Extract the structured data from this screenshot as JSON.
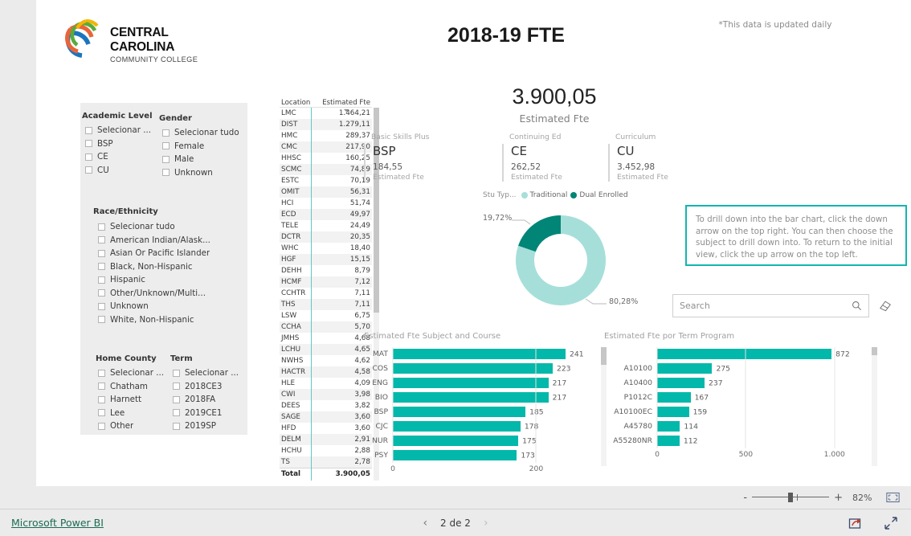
{
  "header": {
    "logo_line1": "CENTRAL CAROLINA",
    "logo_line2": "COMMUNITY COLLEGE",
    "title": "2018-19 FTE",
    "update_note": "*This data is updated daily"
  },
  "slicers": [
    {
      "title": "Academic Level",
      "items": [
        "Selecionar ...",
        "BSP",
        "CE",
        "CU"
      ]
    },
    {
      "title": "Gender",
      "items": [
        "Selecionar tudo",
        "Female",
        "Male",
        "Unknown"
      ]
    },
    {
      "title": "Race/Ethnicity",
      "items": [
        "Selecionar tudo",
        "American Indian/Alask...",
        "Asian Or Pacific Islander",
        "Black, Non-Hispanic",
        "Hispanic",
        "Other/Unknown/Multi...",
        "Unknown",
        "White, Non-Hispanic"
      ]
    },
    {
      "title": "Home County",
      "items": [
        "Selecionar ...",
        "Chatham",
        "Harnett",
        "Lee",
        "Other"
      ]
    },
    {
      "title": "Term",
      "items": [
        "Selecionar ...",
        "2018CE3",
        "2018FA",
        "2019CE1",
        "2019SP"
      ]
    }
  ],
  "table": {
    "columns": [
      "Location",
      "Estimated Fte"
    ],
    "rows": [
      [
        "LMC",
        "1.464,21"
      ],
      [
        "DIST",
        "1.279,11"
      ],
      [
        "HMC",
        "289,37"
      ],
      [
        "CMC",
        "217,90"
      ],
      [
        "HHSC",
        "160,25"
      ],
      [
        "SCMC",
        "74,89"
      ],
      [
        "ESTC",
        "70,19"
      ],
      [
        "OMIT",
        "56,31"
      ],
      [
        "HCI",
        "51,74"
      ],
      [
        "ECD",
        "49,97"
      ],
      [
        "TELE",
        "24,49"
      ],
      [
        "DCTR",
        "20,35"
      ],
      [
        "WHC",
        "18,40"
      ],
      [
        "HGF",
        "15,15"
      ],
      [
        "DEHH",
        "8,79"
      ],
      [
        "HCMF",
        "7,12"
      ],
      [
        "CCHTR",
        "7,11"
      ],
      [
        "THS",
        "7,11"
      ],
      [
        "LSW",
        "6,75"
      ],
      [
        "CCHA",
        "5,70"
      ],
      [
        "JMHS",
        "4,68"
      ],
      [
        "LCHU",
        "4,65"
      ],
      [
        "NWHS",
        "4,62"
      ],
      [
        "HACTR",
        "4,58"
      ],
      [
        "HLE",
        "4,09"
      ],
      [
        "CWI",
        "3,98"
      ],
      [
        "DEES",
        "3,82"
      ],
      [
        "SAGE",
        "3,60"
      ],
      [
        "HFD",
        "3,60"
      ],
      [
        "DELM",
        "2,91"
      ],
      [
        "HCHU",
        "2,88"
      ],
      [
        "TS",
        "2,78"
      ]
    ],
    "total_label": "Total",
    "total_value": "3.900,05"
  },
  "kpi": {
    "total_value": "3.900,05",
    "total_label": "Estimated Fte",
    "cards": [
      {
        "category": "Basic Skills Plus",
        "code": "BSP",
        "value": "184,55",
        "sublabel": "Estimated Fte"
      },
      {
        "category": "Continuing Ed",
        "code": "CE",
        "value": "262,52",
        "sublabel": "Estimated Fte"
      },
      {
        "category": "Curriculum",
        "code": "CU",
        "value": "3.452,98",
        "sublabel": "Estimated Fte"
      }
    ]
  },
  "info_box": {
    "text": "To drill down into the bar chart, click the down arrow on the top right.  You can then choose the subject to drill down into.  To return to the initial view, click the up arrow on the top left.",
    "border_color": "#13b5b1"
  },
  "search": {
    "placeholder": "Search",
    "value": "",
    "icon": "search-icon",
    "eraser_icon": "eraser-icon"
  },
  "status_bar": {
    "zoom_minus": "-",
    "zoom_plus": "+",
    "zoom_pct": "82%",
    "fit_icon": "fit-to-page-icon"
  },
  "footer": {
    "brand": "Microsoft Power BI",
    "prev_arrow": "‹",
    "next_arrow": "›",
    "page_label": "2 de 2",
    "share_icon": "share-icon",
    "fullscreen_icon": "fullscreen-icon"
  },
  "chart_data": [
    {
      "type": "pie",
      "name": "student-type-donut",
      "title": "",
      "legend_title": "Stu Typ...",
      "legend_position": "top",
      "labels": [
        "Traditional",
        "Dual Enrolled"
      ],
      "values": [
        80.28,
        19.72
      ],
      "value_labels": [
        "80,28%",
        "19,72%"
      ],
      "colors": [
        "#a6dfd9",
        "#008576"
      ]
    },
    {
      "type": "bar",
      "name": "estimated-fte-subject-and-course",
      "title": "Estimated Fte Subject and Course",
      "orientation": "horizontal",
      "categories": [
        "MAT",
        "COS",
        "ENG",
        "BIO",
        "BSP",
        "CJC",
        "NUR",
        "PSY"
      ],
      "values": [
        241,
        223,
        217,
        217,
        185,
        178,
        175,
        173
      ],
      "xlabel": "",
      "ylabel": "",
      "xticks": [
        0,
        200
      ],
      "xtick_labels": [
        "0",
        "200"
      ],
      "xlim": [
        0,
        260
      ],
      "grid": false,
      "color": "#01b8aa"
    },
    {
      "type": "bar",
      "name": "estimated-fte-por-term-program",
      "title": "Estimated Fte por Term Program",
      "orientation": "horizontal",
      "categories": [
        "",
        "A10100",
        "A10400",
        "P1012C",
        "A10100EC",
        "A45780",
        "A55280NR"
      ],
      "values": [
        872,
        275,
        237,
        167,
        159,
        114,
        112
      ],
      "xlabel": "",
      "ylabel": "",
      "xticks": [
        0,
        500,
        1000
      ],
      "xtick_labels": [
        "0",
        "500",
        "1.000"
      ],
      "xlim": [
        0,
        1060
      ],
      "grid": false,
      "color": "#01b8aa"
    }
  ]
}
